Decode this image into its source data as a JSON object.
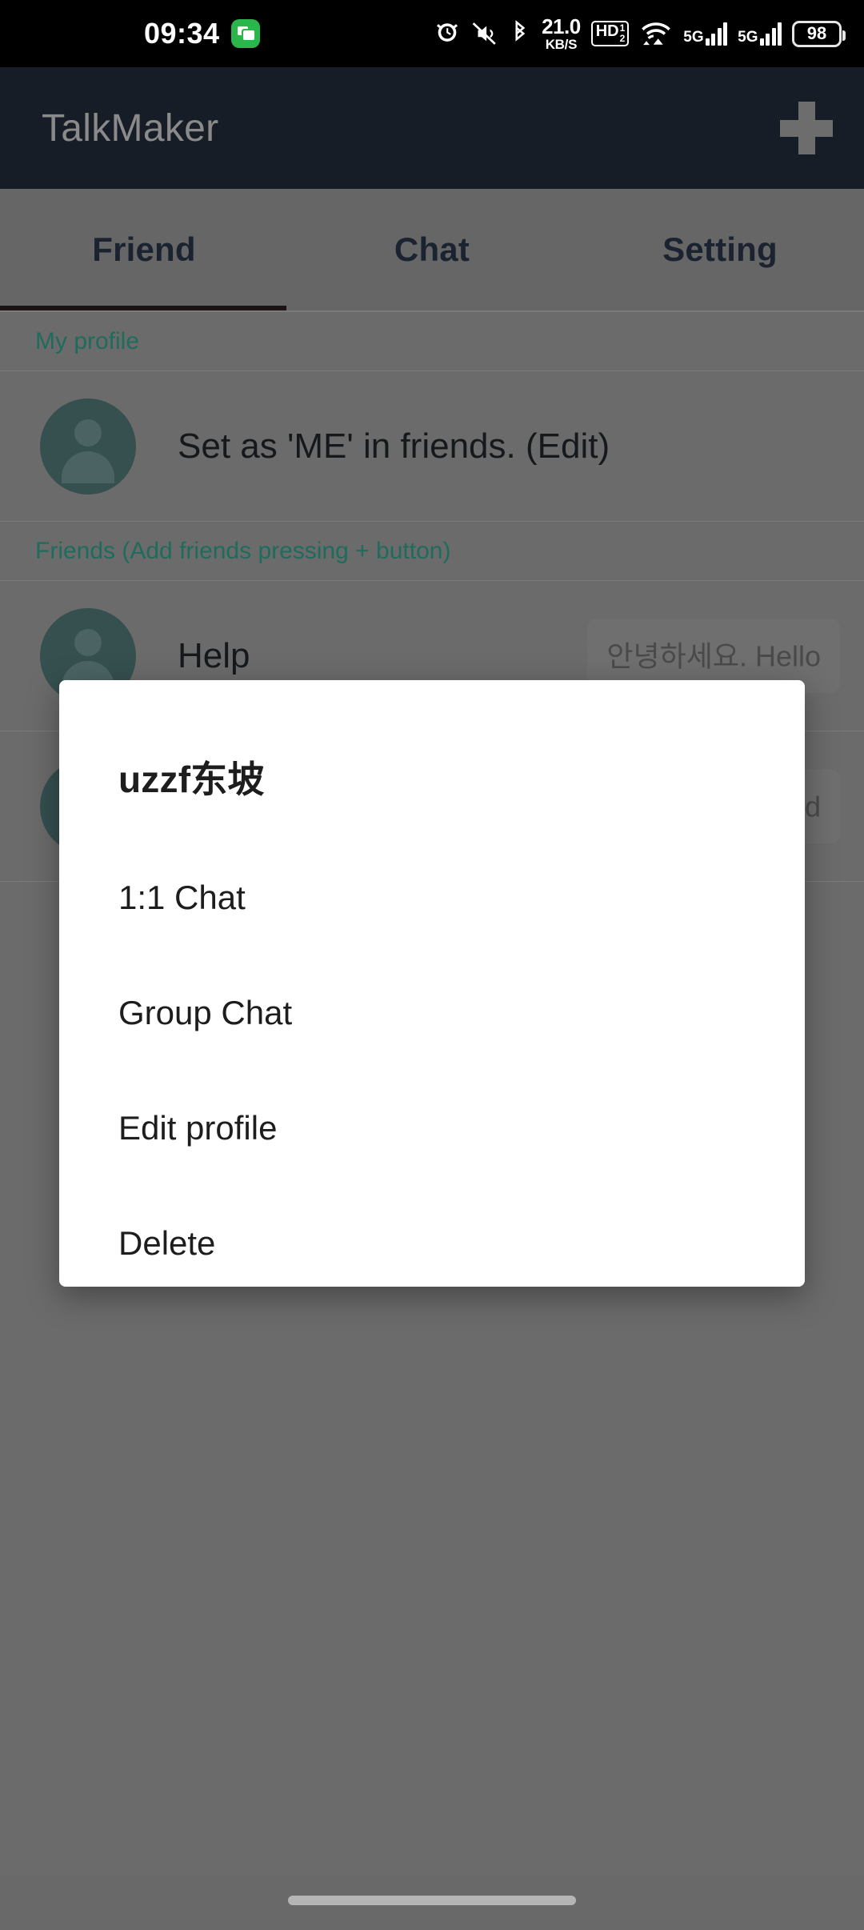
{
  "status_bar": {
    "time": "09:34",
    "message_icon": "message-icon",
    "alarm_icon": "alarm-icon",
    "mute_icon": "mute-icon",
    "bluetooth_icon": "bluetooth-icon",
    "network_speed_value": "21.0",
    "network_speed_unit": "KB/S",
    "hd_label": "HD",
    "hd_sup": "1",
    "hd_sub": "2",
    "wifi_icon": "wifi-icon",
    "sim1_label": "5G",
    "sim2_label": "5G",
    "battery_percent": "98"
  },
  "app_bar": {
    "title": "TalkMaker",
    "add_button_label": "+"
  },
  "tabs": [
    {
      "label": "Friend",
      "selected": true
    },
    {
      "label": "Chat",
      "selected": false
    },
    {
      "label": "Setting",
      "selected": false
    }
  ],
  "content": {
    "my_profile_header": "My profile",
    "my_profile_row": {
      "name": "Set as 'ME' in friends. (Edit)"
    },
    "friends_header": "Friends (Add friends pressing + button)",
    "friends": [
      {
        "name": "Help",
        "bubble": "안녕하세요. Hello"
      },
      {
        "name": "",
        "bubble": "d"
      }
    ]
  },
  "dialog": {
    "title": "uzzf东坡",
    "items": [
      {
        "label": "1:1 Chat"
      },
      {
        "label": "Group Chat"
      },
      {
        "label": "Edit profile"
      },
      {
        "label": "Delete"
      }
    ]
  },
  "colors": {
    "appbar_bg": "#161d26",
    "accent_green": "#1f6b5c",
    "avatar_bg": "#35504f",
    "scrim": "#6b6b6b",
    "status_icon_green": "#2bb64b"
  },
  "nav": {
    "home_indicator": "home-indicator"
  }
}
